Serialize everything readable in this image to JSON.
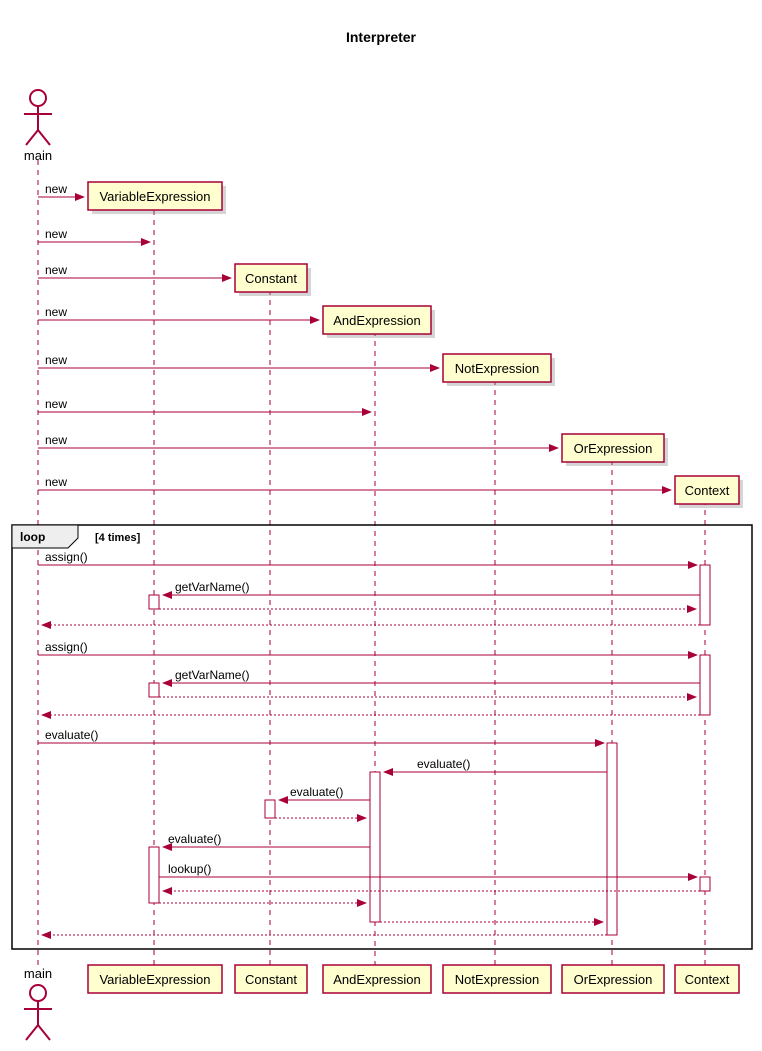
{
  "title": "Interpreter",
  "actor": "main",
  "participants": [
    "VariableExpression",
    "Constant",
    "AndExpression",
    "NotExpression",
    "OrExpression",
    "Context"
  ],
  "messages": {
    "new": "new",
    "assign": "assign()",
    "getVarName": "getVarName()",
    "evaluate": "evaluate()",
    "lookup": "lookup()"
  },
  "loop": {
    "label": "loop",
    "condition": "[4 times]"
  },
  "chart_data": {
    "type": "sequence_diagram",
    "title": "Interpreter",
    "participants": [
      {
        "name": "main",
        "type": "actor"
      },
      {
        "name": "VariableExpression",
        "type": "object"
      },
      {
        "name": "Constant",
        "type": "object"
      },
      {
        "name": "AndExpression",
        "type": "object"
      },
      {
        "name": "NotExpression",
        "type": "object"
      },
      {
        "name": "OrExpression",
        "type": "object"
      },
      {
        "name": "Context",
        "type": "object"
      }
    ],
    "interactions": [
      {
        "from": "main",
        "to": "VariableExpression",
        "label": "new",
        "type": "create"
      },
      {
        "from": "main",
        "to": "VariableExpression",
        "label": "new",
        "type": "call"
      },
      {
        "from": "main",
        "to": "Constant",
        "label": "new",
        "type": "create"
      },
      {
        "from": "main",
        "to": "AndExpression",
        "label": "new",
        "type": "create"
      },
      {
        "from": "main",
        "to": "NotExpression",
        "label": "new",
        "type": "create"
      },
      {
        "from": "main",
        "to": "AndExpression",
        "label": "new",
        "type": "call"
      },
      {
        "from": "main",
        "to": "OrExpression",
        "label": "new",
        "type": "create"
      },
      {
        "from": "main",
        "to": "Context",
        "label": "new",
        "type": "create"
      },
      {
        "type": "fragment",
        "kind": "loop",
        "condition": "4 times",
        "contains": [
          {
            "from": "main",
            "to": "Context",
            "label": "assign()",
            "type": "call"
          },
          {
            "from": "Context",
            "to": "VariableExpression",
            "label": "getVarName()",
            "type": "call"
          },
          {
            "from": "VariableExpression",
            "to": "Context",
            "type": "return"
          },
          {
            "from": "Context",
            "to": "main",
            "type": "return"
          },
          {
            "from": "main",
            "to": "Context",
            "label": "assign()",
            "type": "call"
          },
          {
            "from": "Context",
            "to": "VariableExpression",
            "label": "getVarName()",
            "type": "call"
          },
          {
            "from": "VariableExpression",
            "to": "Context",
            "type": "return"
          },
          {
            "from": "Context",
            "to": "main",
            "type": "return"
          },
          {
            "from": "main",
            "to": "OrExpression",
            "label": "evaluate()",
            "type": "call"
          },
          {
            "from": "OrExpression",
            "to": "AndExpression",
            "label": "evaluate()",
            "type": "call"
          },
          {
            "from": "AndExpression",
            "to": "Constant",
            "label": "evaluate()",
            "type": "call"
          },
          {
            "from": "Constant",
            "to": "AndExpression",
            "type": "return"
          },
          {
            "from": "AndExpression",
            "to": "VariableExpression",
            "label": "evaluate()",
            "type": "call"
          },
          {
            "from": "VariableExpression",
            "to": "Context",
            "label": "lookup()",
            "type": "call"
          },
          {
            "from": "Context",
            "to": "VariableExpression",
            "type": "return"
          },
          {
            "from": "VariableExpression",
            "to": "AndExpression",
            "type": "return"
          },
          {
            "from": "AndExpression",
            "to": "OrExpression",
            "type": "return"
          },
          {
            "from": "OrExpression",
            "to": "main",
            "type": "return"
          }
        ]
      }
    ]
  }
}
